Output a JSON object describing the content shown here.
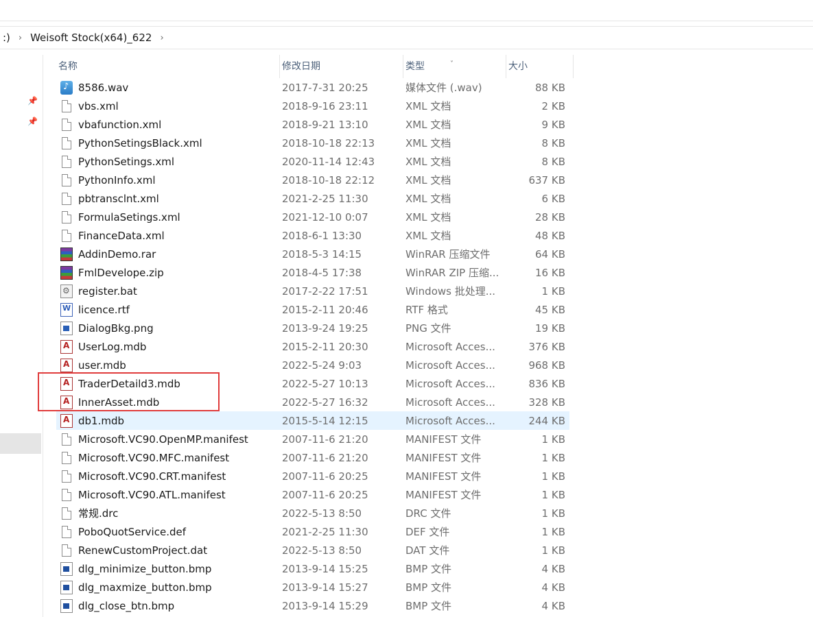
{
  "address": {
    "segments": [
      ":)",
      "Weisoft Stock(x64)_622"
    ]
  },
  "columns": {
    "name": "名称",
    "date": "修改日期",
    "type": "类型",
    "size": "大小"
  },
  "files": [
    {
      "name": "8586.wav",
      "date": "2017-7-31 20:25",
      "type": "媒体文件 (.wav)",
      "size": "88 KB",
      "icon": "wav"
    },
    {
      "name": "vbs.xml",
      "date": "2018-9-16 23:11",
      "type": "XML 文档",
      "size": "2 KB",
      "icon": "doc"
    },
    {
      "name": "vbafunction.xml",
      "date": "2018-9-21 13:10",
      "type": "XML 文档",
      "size": "9 KB",
      "icon": "doc"
    },
    {
      "name": "PythonSetingsBlack.xml",
      "date": "2018-10-18 22:13",
      "type": "XML 文档",
      "size": "8 KB",
      "icon": "doc"
    },
    {
      "name": "PythonSetings.xml",
      "date": "2020-11-14 12:43",
      "type": "XML 文档",
      "size": "8 KB",
      "icon": "doc"
    },
    {
      "name": "PythonInfo.xml",
      "date": "2018-10-18 22:12",
      "type": "XML 文档",
      "size": "637 KB",
      "icon": "doc"
    },
    {
      "name": "pbtransclnt.xml",
      "date": "2021-2-25 11:30",
      "type": "XML 文档",
      "size": "6 KB",
      "icon": "doc"
    },
    {
      "name": "FormulaSetings.xml",
      "date": "2021-12-10 0:07",
      "type": "XML 文档",
      "size": "28 KB",
      "icon": "doc"
    },
    {
      "name": "FinanceData.xml",
      "date": "2018-6-1 13:30",
      "type": "XML 文档",
      "size": "48 KB",
      "icon": "doc"
    },
    {
      "name": "AddinDemo.rar",
      "date": "2018-5-3 14:15",
      "type": "WinRAR 压缩文件",
      "size": "64 KB",
      "icon": "rar"
    },
    {
      "name": "FmlDevelope.zip",
      "date": "2018-4-5 17:38",
      "type": "WinRAR ZIP 压缩...",
      "size": "16 KB",
      "icon": "rar"
    },
    {
      "name": "register.bat",
      "date": "2017-2-22 17:51",
      "type": "Windows 批处理...",
      "size": "1 KB",
      "icon": "bat"
    },
    {
      "name": "licence.rtf",
      "date": "2015-2-11 20:46",
      "type": "RTF 格式",
      "size": "45 KB",
      "icon": "rtf"
    },
    {
      "name": "DialogBkg.png",
      "date": "2013-9-24 19:25",
      "type": "PNG 文件",
      "size": "19 KB",
      "icon": "png"
    },
    {
      "name": "UserLog.mdb",
      "date": "2015-2-11 20:30",
      "type": "Microsoft Acces...",
      "size": "376 KB",
      "icon": "mdb"
    },
    {
      "name": "user.mdb",
      "date": "2022-5-24 9:03",
      "type": "Microsoft Acces...",
      "size": "968 KB",
      "icon": "mdb"
    },
    {
      "name": "TraderDetaild3.mdb",
      "date": "2022-5-27 10:13",
      "type": "Microsoft Acces...",
      "size": "836 KB",
      "icon": "mdb"
    },
    {
      "name": "InnerAsset.mdb",
      "date": "2022-5-27 16:32",
      "type": "Microsoft Acces...",
      "size": "328 KB",
      "icon": "mdb"
    },
    {
      "name": "db1.mdb",
      "date": "2015-5-14 12:15",
      "type": "Microsoft Acces...",
      "size": "244 KB",
      "icon": "mdb",
      "hover": true
    },
    {
      "name": "Microsoft.VC90.OpenMP.manifest",
      "date": "2007-11-6 21:20",
      "type": "MANIFEST 文件",
      "size": "1 KB",
      "icon": "doc"
    },
    {
      "name": "Microsoft.VC90.MFC.manifest",
      "date": "2007-11-6 21:20",
      "type": "MANIFEST 文件",
      "size": "1 KB",
      "icon": "doc"
    },
    {
      "name": "Microsoft.VC90.CRT.manifest",
      "date": "2007-11-6 20:25",
      "type": "MANIFEST 文件",
      "size": "1 KB",
      "icon": "doc"
    },
    {
      "name": "Microsoft.VC90.ATL.manifest",
      "date": "2007-11-6 20:25",
      "type": "MANIFEST 文件",
      "size": "1 KB",
      "icon": "doc"
    },
    {
      "name": "常规.drc",
      "date": "2022-5-13 8:50",
      "type": "DRC 文件",
      "size": "1 KB",
      "icon": "doc"
    },
    {
      "name": "PoboQuotService.def",
      "date": "2021-2-25 11:30",
      "type": "DEF 文件",
      "size": "1 KB",
      "icon": "doc"
    },
    {
      "name": "RenewCustomProject.dat",
      "date": "2022-5-13 8:50",
      "type": "DAT 文件",
      "size": "1 KB",
      "icon": "doc"
    },
    {
      "name": "dlg_minimize_button.bmp",
      "date": "2013-9-14 15:25",
      "type": "BMP 文件",
      "size": "4 KB",
      "icon": "bmp"
    },
    {
      "name": "dlg_maxmize_button.bmp",
      "date": "2013-9-14 15:27",
      "type": "BMP 文件",
      "size": "4 KB",
      "icon": "bmp"
    },
    {
      "name": "dlg_close_btn.bmp",
      "date": "2013-9-14 15:29",
      "type": "BMP 文件",
      "size": "4 KB",
      "icon": "bmp"
    }
  ],
  "colors": {
    "hover_row": "#e5f3ff",
    "highlight_border": "#e03b3b",
    "header_text": "#4c607a"
  }
}
